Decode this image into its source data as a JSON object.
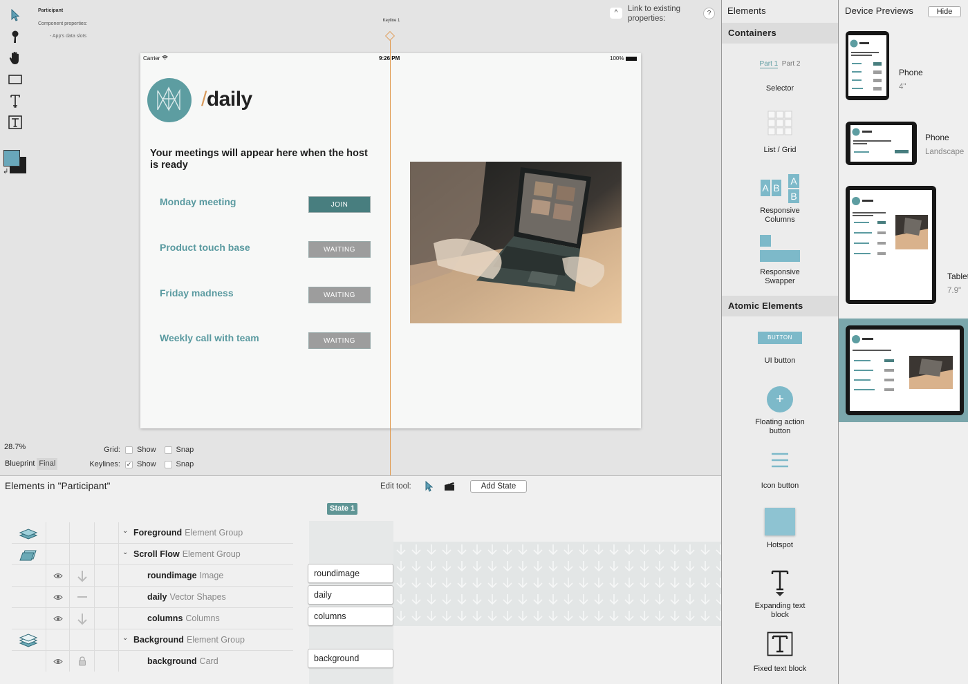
{
  "component": {
    "name": "Participant",
    "properties_label": "Component properties:",
    "data_slots_label": "- App's data slots"
  },
  "link_props": {
    "caret": "^",
    "text": "Link to existing properties:",
    "help": "?"
  },
  "keyline_label": "Keyline 1",
  "device": {
    "carrier": "Carrier",
    "time": "9:26 PM",
    "battery": "100%",
    "brand_slash": "/",
    "brand_name": "daily",
    "headline": "Your meetings will appear here when the host is ready",
    "meetings": [
      {
        "name": "Monday meeting",
        "button": "JOIN",
        "state": "join"
      },
      {
        "name": "Product touch base",
        "button": "WAITING",
        "state": "waiting"
      },
      {
        "name": "Friday madness",
        "button": "WAITING",
        "state": "waiting"
      },
      {
        "name": "Weekly call with team",
        "button": "WAITING",
        "state": "waiting"
      }
    ],
    "colors": {
      "accent": "#5a9aa0",
      "join": "#487e7f",
      "waiting": "#9d9d9d",
      "brand_slash": "#d89a5c"
    }
  },
  "canvas_controls": {
    "zoom": "28.7%",
    "blueprint": "Blueprint",
    "final": "Final",
    "grid_label": "Grid:",
    "keylines_label": "Keylines:",
    "show": "Show",
    "snap": "Snap",
    "grid_show_checked": false,
    "grid_snap_checked": false,
    "keylines_show_checked": true,
    "keylines_snap_checked": false,
    "checkmark": "✓"
  },
  "bottom": {
    "title": "Elements in \"Participant\"",
    "edit_tool": "Edit tool:",
    "add_state": "Add State",
    "state_chip": "State 1",
    "rows": [
      {
        "name": "Foreground",
        "type": "Element Group",
        "group": true
      },
      {
        "name": "Scroll Flow",
        "type": "Element Group",
        "group": true
      },
      {
        "name": "roundimage",
        "type": "Image",
        "group": false
      },
      {
        "name": "daily",
        "type": "Vector Shapes",
        "group": false
      },
      {
        "name": "columns",
        "type": "Columns",
        "group": false
      },
      {
        "name": "Background",
        "type": "Element Group",
        "group": true
      },
      {
        "name": "background",
        "type": "Card",
        "group": false
      }
    ],
    "state_boxes": [
      "roundimage",
      "daily",
      "columns",
      "background"
    ]
  },
  "elements_panel": {
    "title": "Elements",
    "containers_header": "Containers",
    "atomic_header": "Atomic Elements",
    "selector_tabs": [
      "Part 1",
      "Part 2"
    ],
    "containers": [
      "Selector",
      "List / Grid",
      "Responsive Columns",
      "Responsive Swapper"
    ],
    "atomic": [
      "UI button",
      "Floating action button",
      "Icon button",
      "Hotspot",
      "Expanding text block",
      "Fixed text block"
    ],
    "button_sample": "BUTTON",
    "responsive_letters": [
      "A",
      "B",
      "A",
      "B"
    ],
    "fab_plus": "+"
  },
  "previews": {
    "title": "Device Previews",
    "hide": "Hide",
    "devices": [
      {
        "name": "Phone",
        "detail": "4\""
      },
      {
        "name": "Phone",
        "detail": "Landscape"
      },
      {
        "name": "Tablet",
        "detail": "7.9\""
      }
    ]
  }
}
